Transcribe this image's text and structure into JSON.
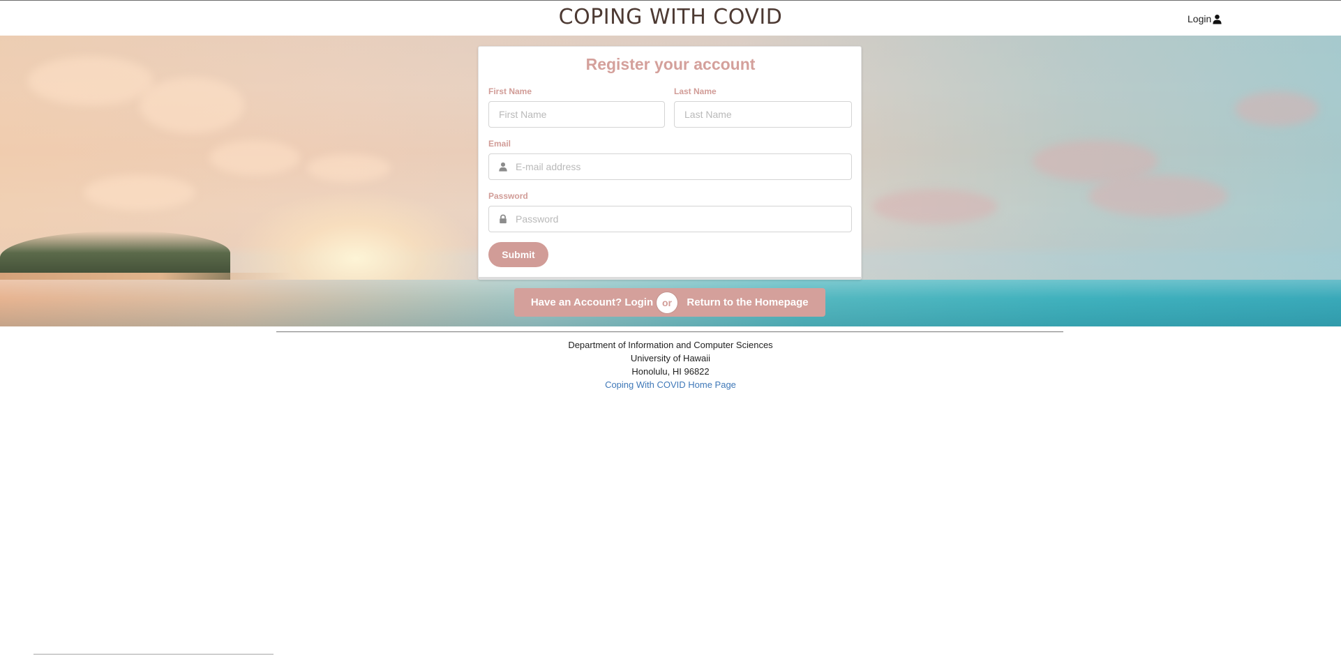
{
  "header": {
    "brand": "COPING WITH COVID",
    "login_label": "Login",
    "login_icon": "user-icon"
  },
  "register": {
    "title": "Register your account",
    "first_name": {
      "label": "First Name",
      "placeholder": "First Name",
      "value": ""
    },
    "last_name": {
      "label": "Last Name",
      "placeholder": "Last Name",
      "value": ""
    },
    "email": {
      "label": "Email",
      "placeholder": "E-mail address",
      "value": "",
      "icon": "user-icon"
    },
    "password": {
      "label": "Password",
      "placeholder": "Password",
      "value": "",
      "icon": "lock-icon"
    },
    "submit_label": "Submit"
  },
  "actions": {
    "login_label": "Have an Account? Login",
    "or_label": "or",
    "home_label": "Return to the Homepage"
  },
  "footer": {
    "line1": "Department of Information and Computer Sciences",
    "line2": "University of Hawaii",
    "line3": "Honolulu, HI 96822",
    "link_label": "Coping With COVID Home Page"
  },
  "colors": {
    "accent": "#d19c97",
    "brand_text": "#4d3a33",
    "link": "#3f78b8"
  }
}
